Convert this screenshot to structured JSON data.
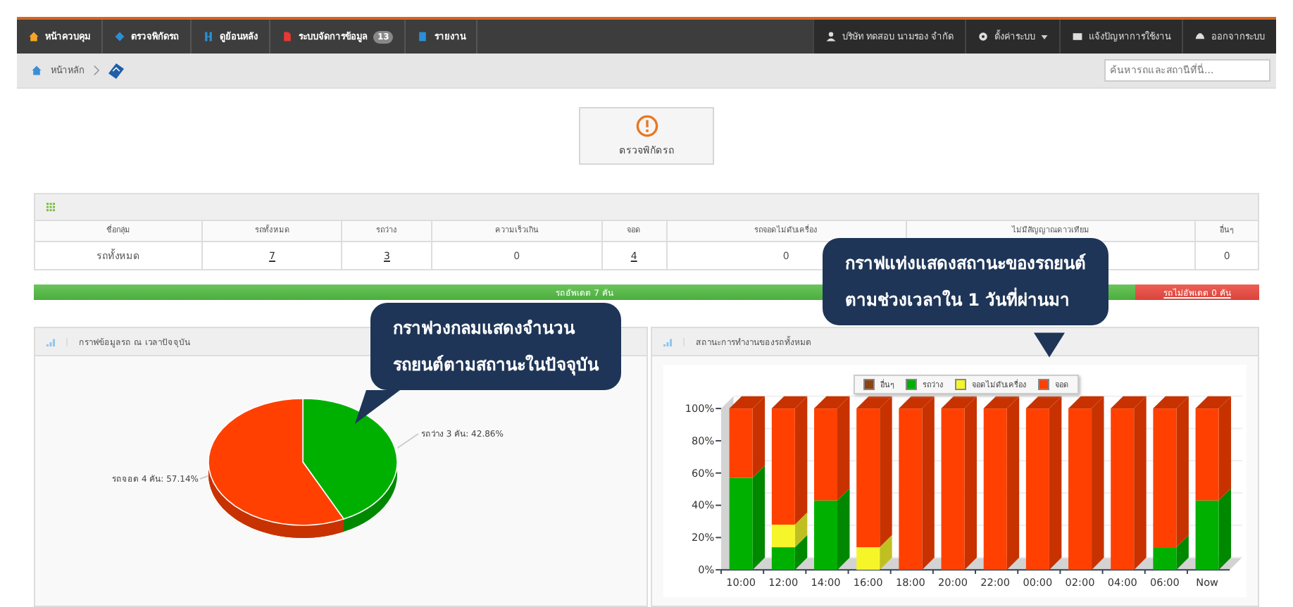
{
  "nav": {
    "items": [
      {
        "label": "หน้าควบคุม"
      },
      {
        "label": "ตรวจพิกัดรถ"
      },
      {
        "label": "ดูย้อนหลัง"
      },
      {
        "label": "ระบบจัดการข้อมูล",
        "badge": "13"
      },
      {
        "label": "รายงาน"
      }
    ],
    "right": [
      {
        "label": "บริษัท ทดสอบ นามรอง จำกัด",
        "caret": false
      },
      {
        "label": "ตั้งค่าระบบ",
        "caret": true
      },
      {
        "label": "แจ้งปัญหาการใช้งาน",
        "caret": false
      },
      {
        "label": "ออกจากระบบ",
        "caret": false
      }
    ]
  },
  "breadcrumb": {
    "items": [
      "หน้าหลัก"
    ]
  },
  "search": {
    "placeholder": "ค้นหารถและสถานีที่นี่..."
  },
  "check_button": {
    "label": "ตรวจพิกัดรถ"
  },
  "table": {
    "columns": [
      "ชื่อกลุ่ม",
      "รถทั้งหมด",
      "รถว่าง",
      "ความเร็วเกิน",
      "จอด",
      "รถจอดไม่ดับเครื่อง",
      "ไม่มีสัญญาณดาวเทียม",
      "อื่นๆ"
    ],
    "rows": [
      {
        "cells": [
          {
            "text": "รถทั้งหมด",
            "link": false
          },
          {
            "text": "7",
            "link": true
          },
          {
            "text": "3",
            "link": true
          },
          {
            "text": "0",
            "link": false
          },
          {
            "text": "4",
            "link": true
          },
          {
            "text": "0",
            "link": false
          },
          {},
          {
            "text": "0",
            "link": false
          }
        ]
      }
    ]
  },
  "update_bar": {
    "updated": "รถอัพเดต 7 คัน",
    "not_updated": "รถไม่อัพเดต 0 คัน"
  },
  "pie_panel": {
    "title": "กราฟข้อมูลรถ ณ เวลาปัจจุบัน",
    "chart_data": {
      "type": "pie",
      "categories": [
        "รถว่าง 3 คัน: 42.86%",
        "รถจอด 4 คัน: 57.14%"
      ],
      "values": [
        42.86,
        57.14
      ]
    }
  },
  "bar_panel": {
    "title": "สถานะการทำงานของรถทั้งหมด",
    "chart_data": {
      "type": "bar",
      "stacked": true,
      "legend": "top",
      "categories": [
        "10:00",
        "12:00",
        "14:00",
        "16:00",
        "18:00",
        "20:00",
        "22:00",
        "00:00",
        "02:00",
        "04:00",
        "06:00",
        "Now"
      ],
      "series": [
        {
          "name": "อื่นๆ",
          "color": "#8b4513",
          "values": [
            0,
            0,
            0,
            0,
            0,
            0,
            0,
            0,
            0,
            0,
            0,
            0
          ]
        },
        {
          "name": "รถว่าง",
          "color": "#00b000",
          "values": [
            57,
            14,
            43,
            0,
            0,
            0,
            0,
            0,
            0,
            0,
            14,
            43
          ]
        },
        {
          "name": "จอดไม่ดับเครื่อง",
          "color": "#f5f52a",
          "values": [
            0,
            14,
            0,
            14,
            0,
            0,
            0,
            0,
            0,
            0,
            0,
            0
          ]
        },
        {
          "name": "จอด",
          "color": "#ff4000",
          "values": [
            43,
            72,
            57,
            86,
            100,
            100,
            100,
            100,
            100,
            100,
            86,
            57
          ]
        }
      ],
      "ylim": [
        0,
        100
      ],
      "yticks": [
        {
          "value": 0,
          "label": "0%"
        },
        {
          "value": 20,
          "label": "20%"
        },
        {
          "value": 40,
          "label": "40%"
        },
        {
          "value": 60,
          "label": "60%"
        },
        {
          "value": 80,
          "label": "80%"
        },
        {
          "value": 100,
          "label": "100%"
        }
      ]
    }
  },
  "callouts": [
    {
      "lines": [
        "กราฟวงกลมแสดงจำนวน",
        "รถยนต์ตามสถานะในปัจจุบัน"
      ]
    },
    {
      "lines": [
        "กราฟแท่งแสดงสถานะของรถยนต์",
        "ตามช่วงเวลาใน 1 วันที่ผ่านมา"
      ]
    }
  ]
}
